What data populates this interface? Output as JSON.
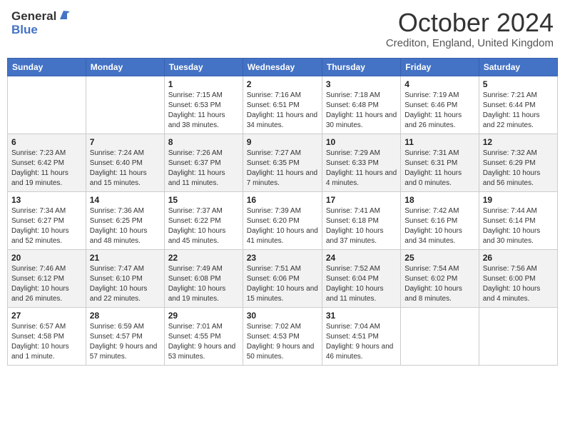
{
  "header": {
    "logo_general": "General",
    "logo_blue": "Blue",
    "month_title": "October 2024",
    "location": "Crediton, England, United Kingdom"
  },
  "days_of_week": [
    "Sunday",
    "Monday",
    "Tuesday",
    "Wednesday",
    "Thursday",
    "Friday",
    "Saturday"
  ],
  "weeks": [
    [
      {
        "day": "",
        "info": ""
      },
      {
        "day": "",
        "info": ""
      },
      {
        "day": "1",
        "info": "Sunrise: 7:15 AM\nSunset: 6:53 PM\nDaylight: 11 hours and 38 minutes."
      },
      {
        "day": "2",
        "info": "Sunrise: 7:16 AM\nSunset: 6:51 PM\nDaylight: 11 hours and 34 minutes."
      },
      {
        "day": "3",
        "info": "Sunrise: 7:18 AM\nSunset: 6:48 PM\nDaylight: 11 hours and 30 minutes."
      },
      {
        "day": "4",
        "info": "Sunrise: 7:19 AM\nSunset: 6:46 PM\nDaylight: 11 hours and 26 minutes."
      },
      {
        "day": "5",
        "info": "Sunrise: 7:21 AM\nSunset: 6:44 PM\nDaylight: 11 hours and 22 minutes."
      }
    ],
    [
      {
        "day": "6",
        "info": "Sunrise: 7:23 AM\nSunset: 6:42 PM\nDaylight: 11 hours and 19 minutes."
      },
      {
        "day": "7",
        "info": "Sunrise: 7:24 AM\nSunset: 6:40 PM\nDaylight: 11 hours and 15 minutes."
      },
      {
        "day": "8",
        "info": "Sunrise: 7:26 AM\nSunset: 6:37 PM\nDaylight: 11 hours and 11 minutes."
      },
      {
        "day": "9",
        "info": "Sunrise: 7:27 AM\nSunset: 6:35 PM\nDaylight: 11 hours and 7 minutes."
      },
      {
        "day": "10",
        "info": "Sunrise: 7:29 AM\nSunset: 6:33 PM\nDaylight: 11 hours and 4 minutes."
      },
      {
        "day": "11",
        "info": "Sunrise: 7:31 AM\nSunset: 6:31 PM\nDaylight: 11 hours and 0 minutes."
      },
      {
        "day": "12",
        "info": "Sunrise: 7:32 AM\nSunset: 6:29 PM\nDaylight: 10 hours and 56 minutes."
      }
    ],
    [
      {
        "day": "13",
        "info": "Sunrise: 7:34 AM\nSunset: 6:27 PM\nDaylight: 10 hours and 52 minutes."
      },
      {
        "day": "14",
        "info": "Sunrise: 7:36 AM\nSunset: 6:25 PM\nDaylight: 10 hours and 48 minutes."
      },
      {
        "day": "15",
        "info": "Sunrise: 7:37 AM\nSunset: 6:22 PM\nDaylight: 10 hours and 45 minutes."
      },
      {
        "day": "16",
        "info": "Sunrise: 7:39 AM\nSunset: 6:20 PM\nDaylight: 10 hours and 41 minutes."
      },
      {
        "day": "17",
        "info": "Sunrise: 7:41 AM\nSunset: 6:18 PM\nDaylight: 10 hours and 37 minutes."
      },
      {
        "day": "18",
        "info": "Sunrise: 7:42 AM\nSunset: 6:16 PM\nDaylight: 10 hours and 34 minutes."
      },
      {
        "day": "19",
        "info": "Sunrise: 7:44 AM\nSunset: 6:14 PM\nDaylight: 10 hours and 30 minutes."
      }
    ],
    [
      {
        "day": "20",
        "info": "Sunrise: 7:46 AM\nSunset: 6:12 PM\nDaylight: 10 hours and 26 minutes."
      },
      {
        "day": "21",
        "info": "Sunrise: 7:47 AM\nSunset: 6:10 PM\nDaylight: 10 hours and 22 minutes."
      },
      {
        "day": "22",
        "info": "Sunrise: 7:49 AM\nSunset: 6:08 PM\nDaylight: 10 hours and 19 minutes."
      },
      {
        "day": "23",
        "info": "Sunrise: 7:51 AM\nSunset: 6:06 PM\nDaylight: 10 hours and 15 minutes."
      },
      {
        "day": "24",
        "info": "Sunrise: 7:52 AM\nSunset: 6:04 PM\nDaylight: 10 hours and 11 minutes."
      },
      {
        "day": "25",
        "info": "Sunrise: 7:54 AM\nSunset: 6:02 PM\nDaylight: 10 hours and 8 minutes."
      },
      {
        "day": "26",
        "info": "Sunrise: 7:56 AM\nSunset: 6:00 PM\nDaylight: 10 hours and 4 minutes."
      }
    ],
    [
      {
        "day": "27",
        "info": "Sunrise: 6:57 AM\nSunset: 4:58 PM\nDaylight: 10 hours and 1 minute."
      },
      {
        "day": "28",
        "info": "Sunrise: 6:59 AM\nSunset: 4:57 PM\nDaylight: 9 hours and 57 minutes."
      },
      {
        "day": "29",
        "info": "Sunrise: 7:01 AM\nSunset: 4:55 PM\nDaylight: 9 hours and 53 minutes."
      },
      {
        "day": "30",
        "info": "Sunrise: 7:02 AM\nSunset: 4:53 PM\nDaylight: 9 hours and 50 minutes."
      },
      {
        "day": "31",
        "info": "Sunrise: 7:04 AM\nSunset: 4:51 PM\nDaylight: 9 hours and 46 minutes."
      },
      {
        "day": "",
        "info": ""
      },
      {
        "day": "",
        "info": ""
      }
    ]
  ]
}
